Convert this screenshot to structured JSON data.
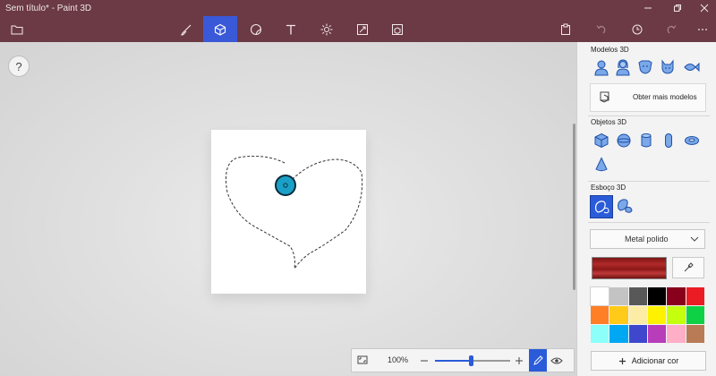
{
  "window": {
    "title": "Sem título* - Paint 3D"
  },
  "toolbar": {
    "tools": [
      "brushes-icon",
      "3d-shapes-icon",
      "stickers-icon",
      "text-icon",
      "effects-icon",
      "canvas-icon",
      "library-icon"
    ],
    "active": "3d-shapes-icon"
  },
  "canvas": {
    "help_label": "?"
  },
  "zoom": {
    "value": "100%",
    "level_fraction": 0.48
  },
  "panel": {
    "models_title": "Modelos 3D",
    "get_more_label": "Obter mais modelos",
    "objects_title": "Objetos 3D",
    "sketch_title": "Esboço 3D",
    "material_value": "Metal polido",
    "add_color_label": "Adicionar cor",
    "palette": [
      "#ffffff",
      "#c3c3c3",
      "#585858",
      "#000000",
      "#88001b",
      "#ec1c24",
      "#ff7f27",
      "#ffca18",
      "#fdeca6",
      "#fff200",
      "#c4ff0e",
      "#0ed145",
      "#8cfffb",
      "#00a8f3",
      "#3f48cc",
      "#b83dba",
      "#ffaec8",
      "#b97a56"
    ],
    "current_color": "#a82525",
    "accent": "#2a5bd8"
  }
}
